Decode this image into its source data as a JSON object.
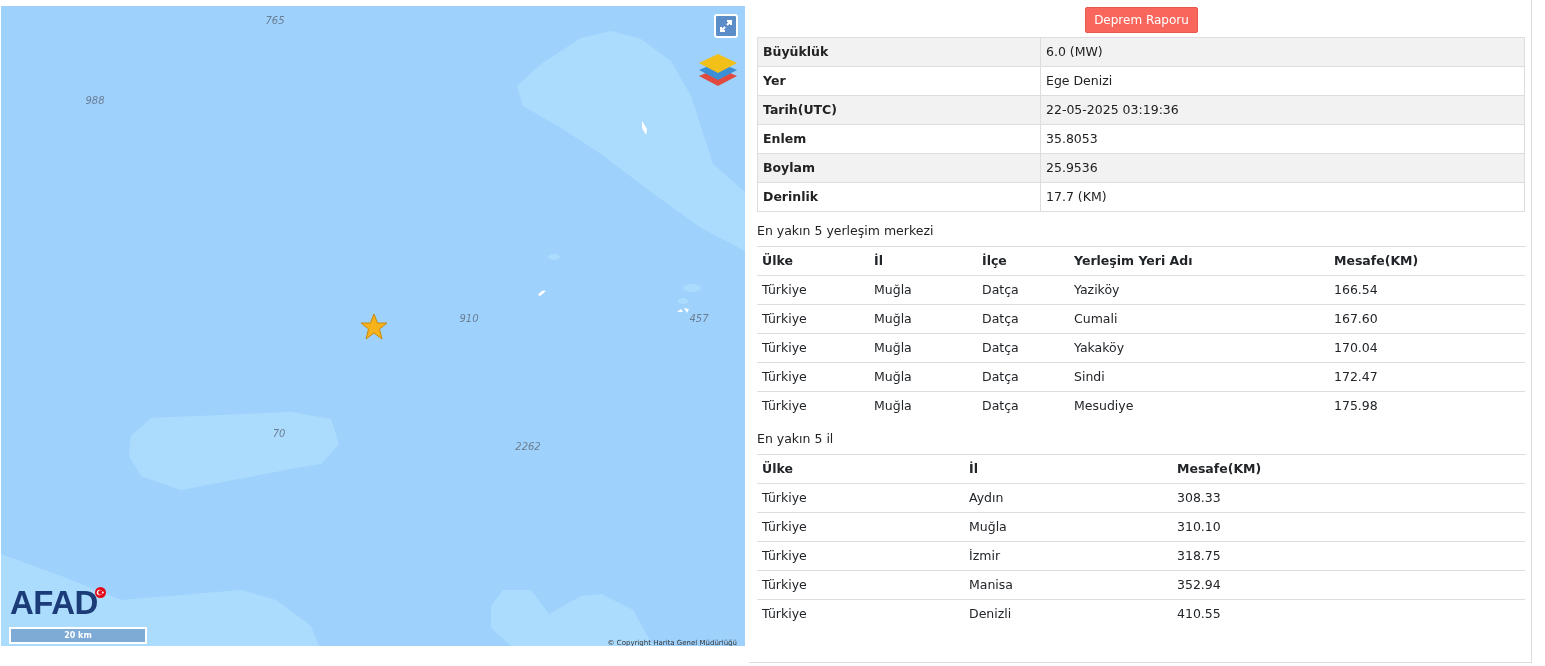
{
  "map": {
    "depth_labels": [
      "765",
      "988",
      "910",
      "457",
      "70",
      "2262"
    ],
    "logo": "AFAD",
    "scale": "20 km",
    "copyright": "© Copyright Harita Genel Müdürlüğü"
  },
  "report_button": "Deprem Raporu",
  "details": [
    {
      "label": "Büyüklük",
      "value": "6.0 (MW)"
    },
    {
      "label": "Yer",
      "value": "Ege Denizi"
    },
    {
      "label": "Tarih(UTC)",
      "value": "22-05-2025 03:19:36"
    },
    {
      "label": "Enlem",
      "value": "35.8053"
    },
    {
      "label": "Boylam",
      "value": "25.9536"
    },
    {
      "label": "Derinlik",
      "value": "17.7 (KM)"
    }
  ],
  "settlements": {
    "title": "En yakın 5 yerleşim merkezi",
    "columns": [
      "Ülke",
      "İl",
      "İlçe",
      "Yerleşim Yeri Adı",
      "Mesafe(KM)"
    ],
    "rows": [
      [
        "Türkiye",
        "Muğla",
        "Datça",
        "Yaziköy",
        "166.54"
      ],
      [
        "Türkiye",
        "Muğla",
        "Datça",
        "Cumali",
        "167.60"
      ],
      [
        "Türkiye",
        "Muğla",
        "Datça",
        "Yakaköy",
        "170.04"
      ],
      [
        "Türkiye",
        "Muğla",
        "Datça",
        "Sindi",
        "172.47"
      ],
      [
        "Türkiye",
        "Muğla",
        "Datça",
        "Mesudiye",
        "175.98"
      ]
    ]
  },
  "provinces": {
    "title": "En yakın 5 il",
    "columns": [
      "Ülke",
      "İl",
      "Mesafe(KM)"
    ],
    "rows": [
      [
        "Türkiye",
        "Aydın",
        "308.33"
      ],
      [
        "Türkiye",
        "Muğla",
        "310.10"
      ],
      [
        "Türkiye",
        "İzmir",
        "318.75"
      ],
      [
        "Türkiye",
        "Manisa",
        "352.94"
      ],
      [
        "Türkiye",
        "Denizli",
        "410.55"
      ]
    ]
  }
}
